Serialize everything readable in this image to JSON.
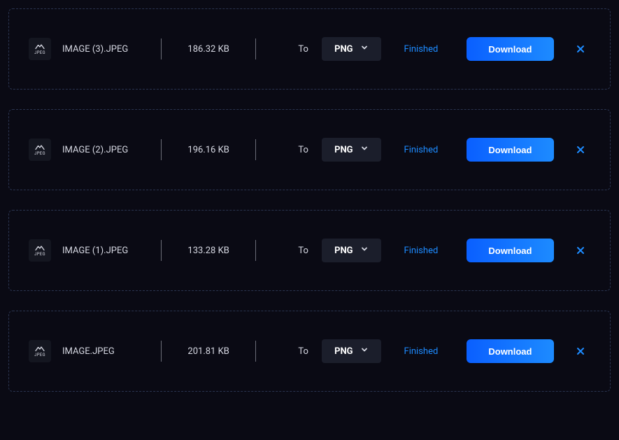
{
  "labels": {
    "to": "To",
    "download": "Download"
  },
  "files": [
    {
      "icon_type": "JPEG",
      "name": "IMAGE (3).JPEG",
      "size": "186.32 KB",
      "format": "PNG",
      "status": "Finished"
    },
    {
      "icon_type": "JPEG",
      "name": "IMAGE (2).JPEG",
      "size": "196.16 KB",
      "format": "PNG",
      "status": "Finished"
    },
    {
      "icon_type": "JPEG",
      "name": "IMAGE (1).JPEG",
      "size": "133.28 KB",
      "format": "PNG",
      "status": "Finished"
    },
    {
      "icon_type": "JPEG",
      "name": "IMAGE.JPEG",
      "size": "201.81 KB",
      "format": "PNG",
      "status": "Finished"
    }
  ]
}
